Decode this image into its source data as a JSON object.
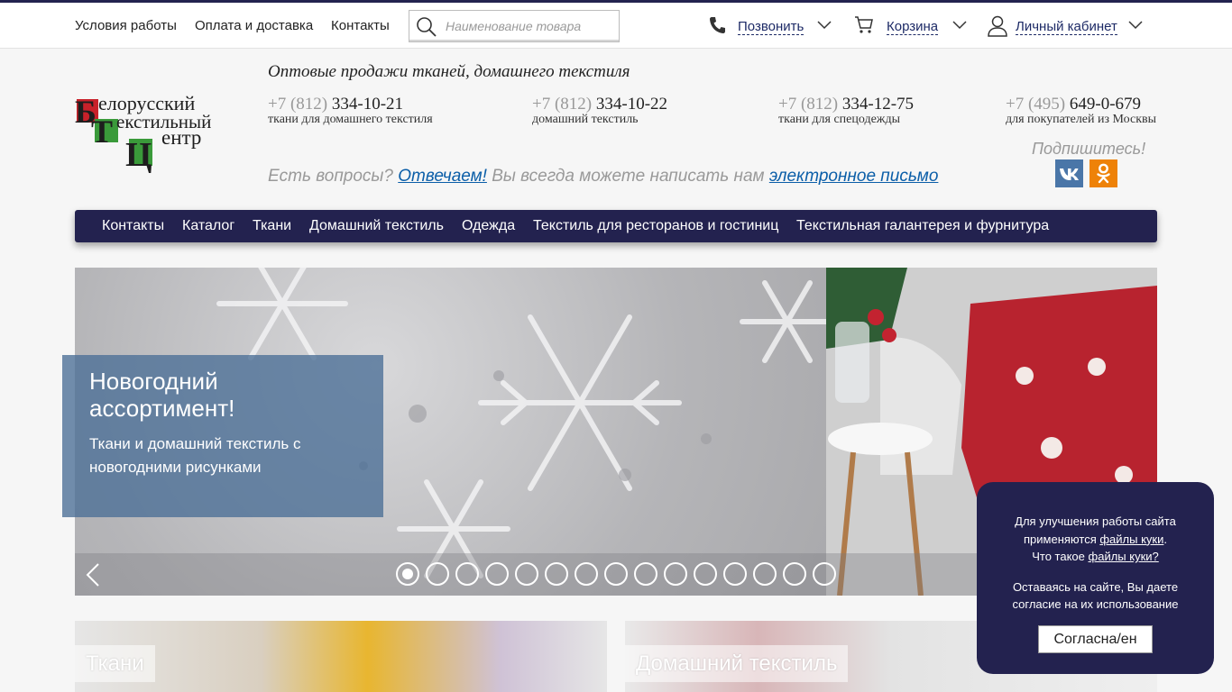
{
  "topbar": {
    "links": [
      "Условия работы",
      "Оплата и доставка",
      "Контакты"
    ],
    "search_placeholder": "Наименование товара",
    "call_label": "Позвонить",
    "cart_label": "Корзина",
    "account_label": "Личный кабинет"
  },
  "logo": {
    "line1": "елорусский",
    "line2": "екстильный",
    "line3": "ентр",
    "letters": [
      "Б",
      "Т",
      "Ц"
    ]
  },
  "header": {
    "tagline": "Оптовые продажи тканей, домашнего текстиля",
    "phones": [
      {
        "prefix": "+7 (812)",
        "number": "334-10-21",
        "desc": "ткани для домашнего текстиля"
      },
      {
        "prefix": "+7 (812)",
        "number": "334-10-22",
        "desc": "домашний текстиль"
      },
      {
        "prefix": "+7 (812)",
        "number": "334-12-75",
        "desc": "ткани для спецодежды"
      },
      {
        "prefix": "+7 (495)",
        "number": "649-0-679",
        "desc": "для покупателей из Москвы"
      }
    ],
    "questions_a": "Есть вопросы?",
    "questions_link1": "Отвечаем!",
    "questions_b": "Вы всегда можете написать нам",
    "questions_link2": "электронное письмо",
    "subscribe": "Подпишитесь!",
    "social": [
      "vk-icon",
      "odnoklassniki-icon"
    ]
  },
  "nav": {
    "items": [
      "Контакты",
      "Каталог",
      "Ткани",
      "Домашний текстиль",
      "Одежда",
      "Текстиль для ресторанов и гостиниц",
      "Текстильная галантерея и фурнитура"
    ]
  },
  "slider": {
    "title": "Новогодний ассортимент!",
    "subtitle": "Ткани и домашний текстиль с новогодними рисунками",
    "slide_count": 15,
    "active_index": 0
  },
  "cards": [
    "Ткани",
    "Домашний текстиль"
  ],
  "cookie": {
    "text1": "Для улучшения работы сайта применяются",
    "link1": "файлы куки",
    "text2": "Что такое",
    "link2": "файлы куки?",
    "text3": "Оставаясь на сайте, Вы даете согласие на их использование",
    "button": "Согласна/ен"
  },
  "colors": {
    "navy": "#23224f",
    "link": "#0b5ea8",
    "vk": "#4a76a8",
    "ok": "#ee8208"
  }
}
